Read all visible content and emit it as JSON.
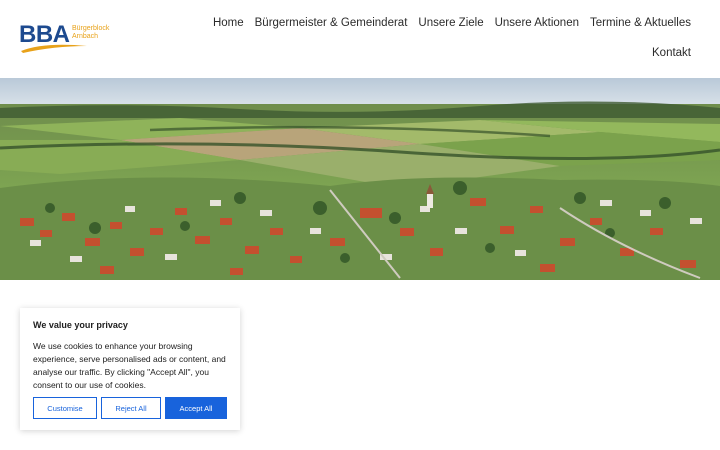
{
  "logo": {
    "abbr": "BBA",
    "sub_line1": "Bürgerblock",
    "sub_line2": "Arnbach"
  },
  "nav": {
    "items": [
      "Home",
      "Bürgermeister & Gemeinderat",
      "Unsere Ziele",
      "Unsere Aktionen",
      "Termine & Aktuelles"
    ],
    "second_row": [
      "Kontakt"
    ]
  },
  "hero": {
    "image_icon": "aerial-village-photo"
  },
  "cookie": {
    "title": "We value your privacy",
    "text": "We use cookies to enhance your browsing experience, serve personalised ads or content, and analyse our traffic. By clicking \"Accept All\", you consent to our use of cookies.",
    "customise_label": "Customise",
    "reject_label": "Reject All",
    "accept_label": "Accept All"
  },
  "colors": {
    "brand_blue": "#1d4a8f",
    "brand_orange": "#e8a21a",
    "button_blue": "#1863dc"
  }
}
